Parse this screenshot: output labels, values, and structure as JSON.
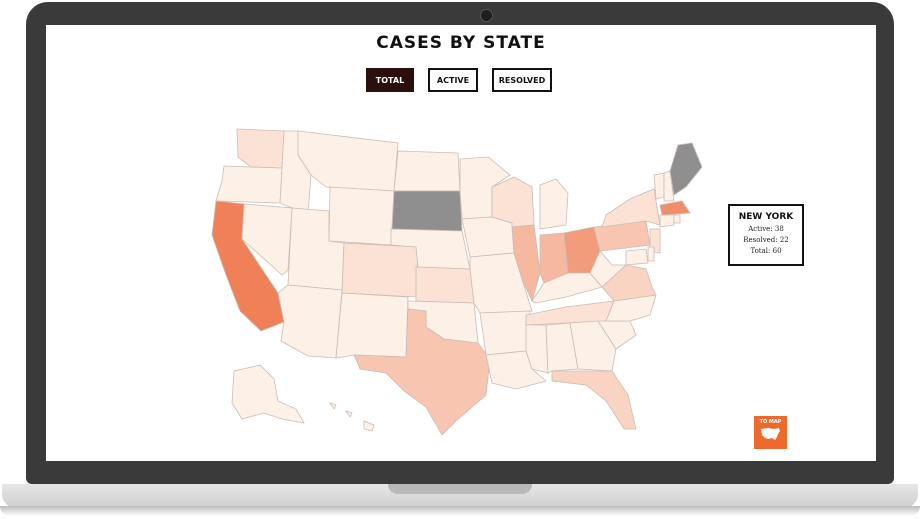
{
  "page": {
    "title": "CASES BY STATE"
  },
  "tabs": [
    {
      "label": "TOTAL",
      "active": true
    },
    {
      "label": "ACTIVE",
      "active": false
    },
    {
      "label": "RESOLVED",
      "active": false
    }
  ],
  "info_card": {
    "state": "NEW YORK",
    "active": "Active: 38",
    "resolved": "Resolved: 22",
    "total": "Total: 60"
  },
  "to_map_button": {
    "label": "TO MAP",
    "icon": "usa-map-icon"
  },
  "colors": {
    "accent": "#ee6a2c",
    "active_tab_bg": "#2b0f0a",
    "no_data": "#8f8f8f",
    "scale_low": "#fdf0e6",
    "scale_high": "#ef8057"
  },
  "choropleth": [
    {
      "state": "Washington",
      "level": 2
    },
    {
      "state": "Oregon",
      "level": 1
    },
    {
      "state": "California",
      "level": 9
    },
    {
      "state": "Nevada",
      "level": 1
    },
    {
      "state": "Idaho",
      "level": 1
    },
    {
      "state": "Montana",
      "level": 1
    },
    {
      "state": "Wyoming",
      "level": 1
    },
    {
      "state": "Utah",
      "level": 1
    },
    {
      "state": "Arizona",
      "level": 1
    },
    {
      "state": "Colorado",
      "level": 2
    },
    {
      "state": "New Mexico",
      "level": 1
    },
    {
      "state": "North Dakota",
      "level": 1
    },
    {
      "state": "South Dakota",
      "level": null
    },
    {
      "state": "Nebraska",
      "level": 1
    },
    {
      "state": "Kansas",
      "level": 2
    },
    {
      "state": "Oklahoma",
      "level": 1
    },
    {
      "state": "Texas",
      "level": 4
    },
    {
      "state": "Minnesota",
      "level": 1
    },
    {
      "state": "Iowa",
      "level": 1
    },
    {
      "state": "Missouri",
      "level": 1
    },
    {
      "state": "Arkansas",
      "level": 1
    },
    {
      "state": "Louisiana",
      "level": 1
    },
    {
      "state": "Wisconsin",
      "level": 2
    },
    {
      "state": "Illinois",
      "level": 5
    },
    {
      "state": "Michigan",
      "level": 1
    },
    {
      "state": "Indiana",
      "level": 5
    },
    {
      "state": "Ohio",
      "level": 7
    },
    {
      "state": "Kentucky",
      "level": 1
    },
    {
      "state": "Tennessee",
      "level": 2
    },
    {
      "state": "Mississippi",
      "level": 1
    },
    {
      "state": "Alabama",
      "level": 1
    },
    {
      "state": "Georgia",
      "level": 1
    },
    {
      "state": "Florida",
      "level": 3
    },
    {
      "state": "South Carolina",
      "level": 1
    },
    {
      "state": "North Carolina",
      "level": 1
    },
    {
      "state": "Virginia",
      "level": 3
    },
    {
      "state": "West Virginia",
      "level": 1
    },
    {
      "state": "Pennsylvania",
      "level": 4
    },
    {
      "state": "New York",
      "level": 2
    },
    {
      "state": "Vermont",
      "level": 1
    },
    {
      "state": "New Hampshire",
      "level": 1
    },
    {
      "state": "Maine",
      "level": null
    },
    {
      "state": "Massachusetts",
      "level": 8
    },
    {
      "state": "Connecticut",
      "level": 1
    },
    {
      "state": "Rhode Island",
      "level": 1
    },
    {
      "state": "New Jersey",
      "level": 2
    },
    {
      "state": "Maryland",
      "level": 1
    },
    {
      "state": "Delaware",
      "level": 1
    },
    {
      "state": "Alaska",
      "level": 1
    },
    {
      "state": "Hawaii",
      "level": 1
    }
  ]
}
